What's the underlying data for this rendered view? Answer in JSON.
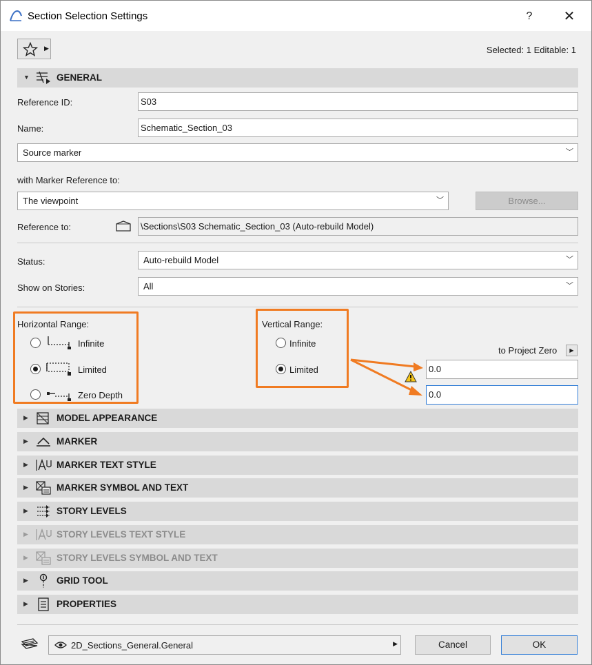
{
  "window": {
    "title": "Section Selection Settings",
    "help_label": "?",
    "close_label": "✕"
  },
  "toolbar": {
    "favorites_icon": "star-icon",
    "selected_info": "Selected: 1 Editable: 1"
  },
  "general": {
    "header": "GENERAL",
    "reference_id_label": "Reference ID:",
    "reference_id_value": "S03",
    "name_label": "Name:",
    "name_value": "Schematic_Section_03",
    "marker_type": "Source marker",
    "marker_ref_label": "with Marker Reference to:",
    "marker_ref_value": "The viewpoint",
    "browse_label": "Browse...",
    "reference_to_label": "Reference to:",
    "reference_to_value": "\\Sections\\S03 Schematic_Section_03 (Auto-rebuild Model)",
    "status_label": "Status:",
    "status_value": "Auto-rebuild Model",
    "stories_label": "Show on Stories:",
    "stories_value": "All"
  },
  "horizontal_range": {
    "label": "Horizontal Range:",
    "options": [
      {
        "label": "Infinite",
        "selected": false
      },
      {
        "label": "Limited",
        "selected": true
      },
      {
        "label": "Zero Depth",
        "selected": false
      }
    ]
  },
  "vertical_range": {
    "label": "Vertical Range:",
    "options": [
      {
        "label": "Infinite",
        "selected": false
      },
      {
        "label": "Limited",
        "selected": true
      }
    ],
    "to_project_zero": "to Project Zero",
    "top_value": "0.0",
    "bottom_value": "0.0"
  },
  "panels": [
    {
      "label": "MODEL APPEARANCE",
      "enabled": true
    },
    {
      "label": "MARKER",
      "enabled": true
    },
    {
      "label": "MARKER TEXT STYLE",
      "enabled": true
    },
    {
      "label": "MARKER SYMBOL AND TEXT",
      "enabled": true
    },
    {
      "label": "STORY LEVELS",
      "enabled": true
    },
    {
      "label": "STORY LEVELS TEXT STYLE",
      "enabled": false
    },
    {
      "label": "STORY LEVELS SYMBOL AND TEXT",
      "enabled": false
    },
    {
      "label": "GRID TOOL",
      "enabled": true
    },
    {
      "label": "PROPERTIES",
      "enabled": true
    }
  ],
  "footer": {
    "layer_value": "2D_Sections_General.General",
    "cancel_label": "Cancel",
    "ok_label": "OK"
  },
  "colors": {
    "highlight": "#f07b22",
    "focus": "#2e7bd6",
    "header_bg": "#d9d9d9"
  }
}
